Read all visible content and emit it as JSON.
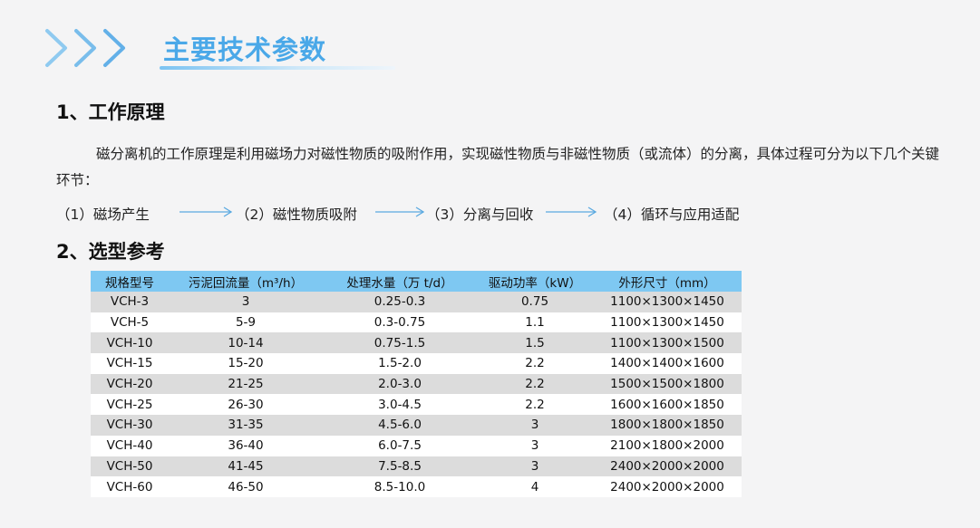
{
  "header": {
    "title": "主要技术参数"
  },
  "section1": {
    "heading": "1、工作原理",
    "paragraph": "磁分离机的工作原理是利用磁场力对磁性物质的吸附作用，实现磁性物质与非磁性物质（或流体）的分离，具体过程可分为以下几个关键环节：",
    "steps": [
      "（1）磁场产生",
      "（2）磁性物质吸附",
      "（3）分离与回收",
      "（4）循环与应用适配"
    ]
  },
  "section2": {
    "heading": "2、选型参考",
    "table": {
      "columns": [
        "规格型号",
        "污泥回流量（m³/h）",
        "处理水量（万 t/d）",
        "驱动功率（kW）",
        "外形尺寸（mm）"
      ],
      "rows": [
        [
          "VCH-3",
          "3",
          "0.25-0.3",
          "0.75",
          "1100×1300×1450"
        ],
        [
          "VCH-5",
          "5-9",
          "0.3-0.75",
          "1.1",
          "1100×1300×1450"
        ],
        [
          "VCH-10",
          "10-14",
          "0.75-1.5",
          "1.5",
          "1100×1300×1500"
        ],
        [
          "VCH-15",
          "15-20",
          "1.5-2.0",
          "2.2",
          "1400×1400×1600"
        ],
        [
          "VCH-20",
          "21-25",
          "2.0-3.0",
          "2.2",
          "1500×1500×1800"
        ],
        [
          "VCH-25",
          "26-30",
          "3.0-4.5",
          "2.2",
          "1600×1600×1850"
        ],
        [
          "VCH-30",
          "31-35",
          "4.5-6.0",
          "3",
          "1800×1800×1850"
        ],
        [
          "VCH-40",
          "36-40",
          "6.0-7.5",
          "3",
          "2100×1800×2000"
        ],
        [
          "VCH-50",
          "41-45",
          "7.5-8.5",
          "3",
          "2400×2000×2000"
        ],
        [
          "VCH-60",
          "46-50",
          "8.5-10.0",
          "4",
          "2400×2000×2000"
        ]
      ]
    }
  },
  "colors": {
    "accent": "#4aa8e8",
    "table_header": "#7ec8f2",
    "row_alt": "#dcdcdc",
    "arrow": "#5aa9e0"
  },
  "icons": {
    "header": "triple-chevron-right-icon",
    "flow_arrow": "arrow-right-icon"
  }
}
